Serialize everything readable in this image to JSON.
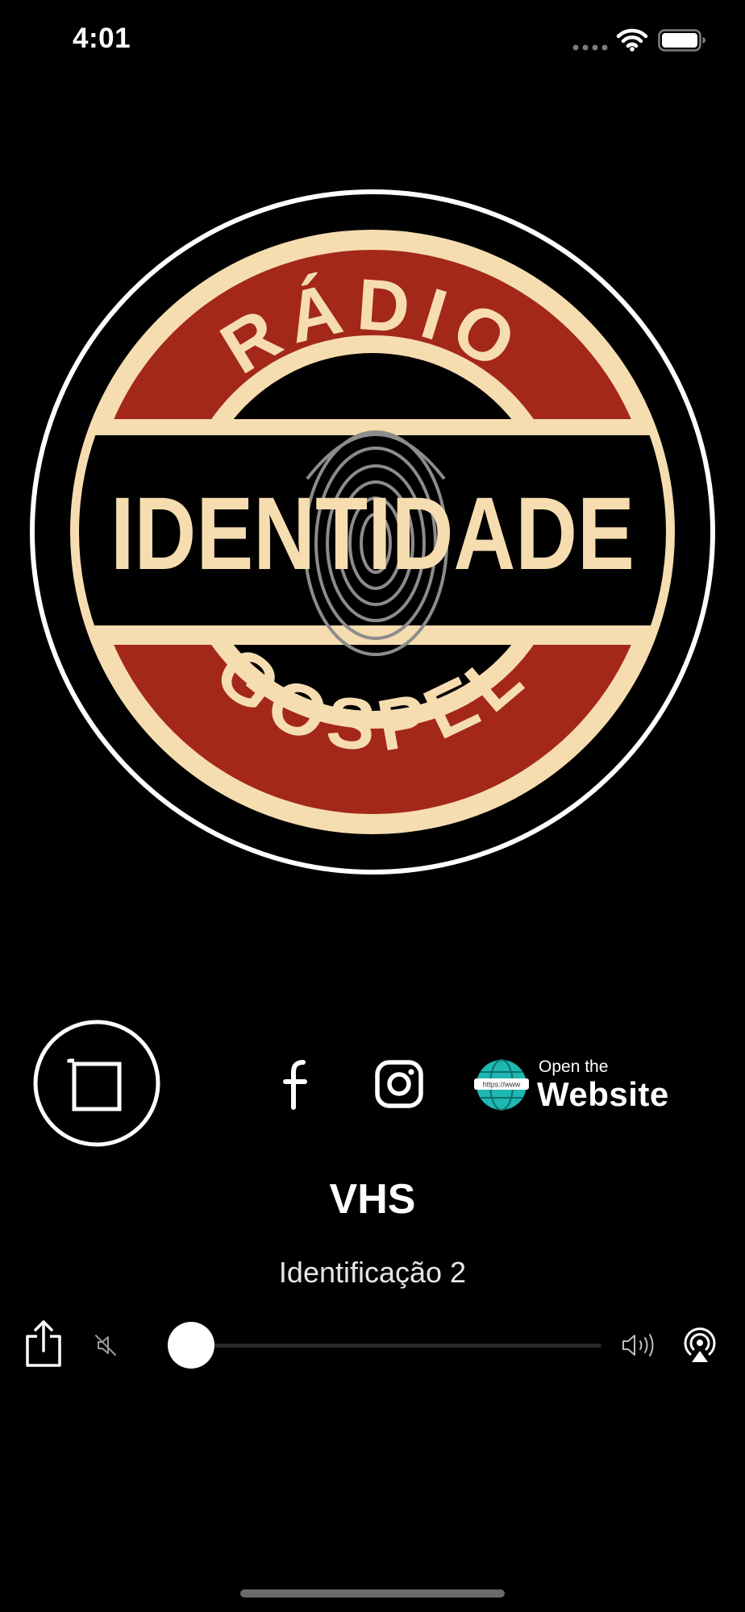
{
  "status_bar": {
    "time": "4:01",
    "icons": [
      "signal-dots-icon",
      "wifi-icon",
      "battery-icon"
    ]
  },
  "logo": {
    "top_text": "RÁDIO",
    "main_text": "IDENTIDADE",
    "bottom_text": "GOSPEL",
    "colors": {
      "red": "#a3281a",
      "cream": "#f6ddb0",
      "black": "#000000",
      "fingerprint": "#8c8c8c"
    }
  },
  "controls": {
    "play_icon": "stop-square-icon",
    "facebook_icon": "facebook-icon",
    "instagram_icon": "instagram-icon",
    "website": {
      "url_text": "https://www",
      "small_label": "Open the",
      "large_label": "Website"
    }
  },
  "track": {
    "title": "VHS",
    "subtitle": "Identificação 2"
  },
  "player": {
    "share_icon": "share-icon",
    "mute_icon": "speaker-mute-icon",
    "volume_level": 0.05,
    "volume_up_icon": "speaker-loud-icon",
    "airplay_icon": "airplay-icon"
  }
}
